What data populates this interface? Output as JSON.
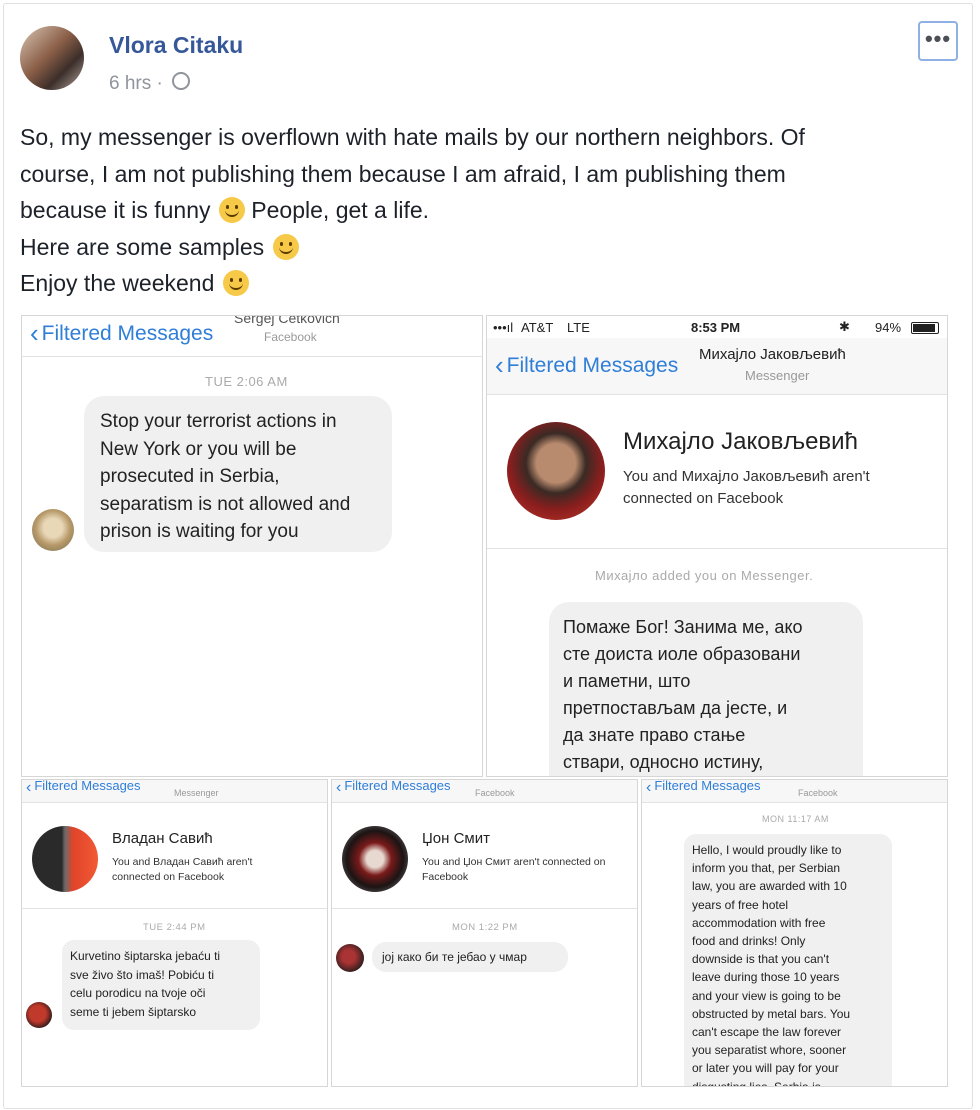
{
  "post": {
    "author": "Vlora Citaku",
    "time": "6 hrs",
    "separator": "·",
    "more_label": "•••",
    "text_lines": [
      "So, my messenger is overflown with hate mails by our northern neighbors. Of",
      "course, I am not publishing them because I am afraid, I am publishing them",
      "because it is funny",
      "People, get a life.",
      "Here are some samples",
      "Enjoy the weekend"
    ]
  },
  "shots": {
    "s1": {
      "back_label": "Filtered Messages",
      "sender": "Sergej Cetkovich",
      "source": "Facebook",
      "timestamp": "TUE 2:06 AM",
      "message_lines": [
        "Stop your terrorist actions in",
        "New York or you will be",
        "prosecuted in Serbia,",
        "separatism is not allowed and",
        "prison is waiting for you"
      ]
    },
    "s2": {
      "carrier": "AT&T",
      "network": "LTE",
      "clock": "8:53 PM",
      "battery": "94%",
      "back_label": "Filtered Messages",
      "sender": "Михајло Јаковљевић",
      "source": "Messenger",
      "profile_name": "Михајло Јаковљевић",
      "profile_note_1": "You and Михајло Јаковљевић aren't",
      "profile_note_2": "connected on Facebook",
      "added_note": "Михајло added you on Messenger.",
      "message_lines": [
        "Помаже Бог! Занима ме, ако",
        "сте доиста иоле образовани",
        "и паметни, што",
        "претпостављам да јесте, и",
        "да знате право стање",
        "ствари, односно истину,"
      ]
    },
    "s3": {
      "back_label": "Filtered Messages",
      "source": "Messenger",
      "profile_name": "Владан Савић",
      "profile_note_1": "You and Владан Савић aren't",
      "profile_note_2": "connected on Facebook",
      "timestamp": "TUE 2:44 PM",
      "message_lines": [
        "Kurvetino šiptarska jebaću ti",
        "sve živo što imaš! Pobiću ti",
        "celu porodicu na tvoje oči",
        "seme ti jebem šiptarsko"
      ]
    },
    "s4": {
      "back_label": "Filtered Messages",
      "source": "Facebook",
      "profile_name": "Џон Смит",
      "profile_note_1": "You and Џон Смит aren't connected on",
      "profile_note_2": "Facebook",
      "timestamp": "MON 1:22 PM",
      "message": "јој како би те јебао у чмар"
    },
    "s5": {
      "back_label": "Filtered Messages",
      "source": "Facebook",
      "timestamp": "MON 11:17 AM",
      "message_lines": [
        "Hello, I would proudly like to",
        "inform you that, per Serbian",
        "law, you are awarded with 10",
        "years of free hotel",
        "accommodation with free",
        "food and drinks! Only",
        "downside is that you can't",
        "leave during those 10 years",
        "and your view is going to be",
        "obstructed by metal bars. You",
        "can't escape the law forever",
        "you separatist whore, sooner",
        "or later you will pay for your",
        "disgusting lies. Serbia is"
      ]
    }
  },
  "colors": {
    "link_blue": "#365899",
    "ios_blue": "#2f7ed8",
    "bubble_gray": "#f1f0f0",
    "meta_gray": "#90949c"
  }
}
